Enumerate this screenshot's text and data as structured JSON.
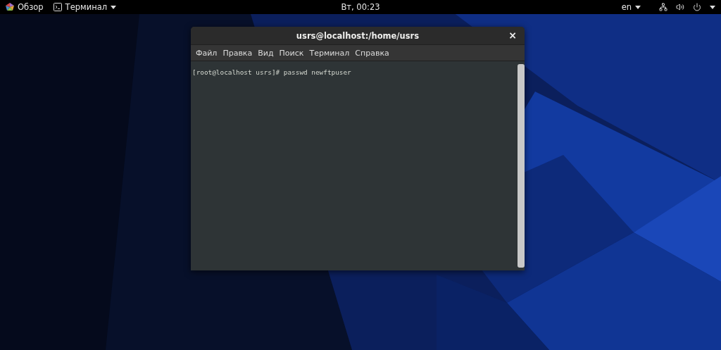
{
  "top_bar": {
    "activities": "Обзор",
    "app_menu": "Терминал",
    "clock": "Вт, 00:23",
    "language": "en"
  },
  "window": {
    "title": "usrs@localhost:/home/usrs",
    "close": "×",
    "menu": [
      "Файл",
      "Правка",
      "Вид",
      "Поиск",
      "Терминал",
      "Справка"
    ],
    "terminal_lines": [
      "[root@localhost usrs]# passwd newftpuser"
    ]
  }
}
